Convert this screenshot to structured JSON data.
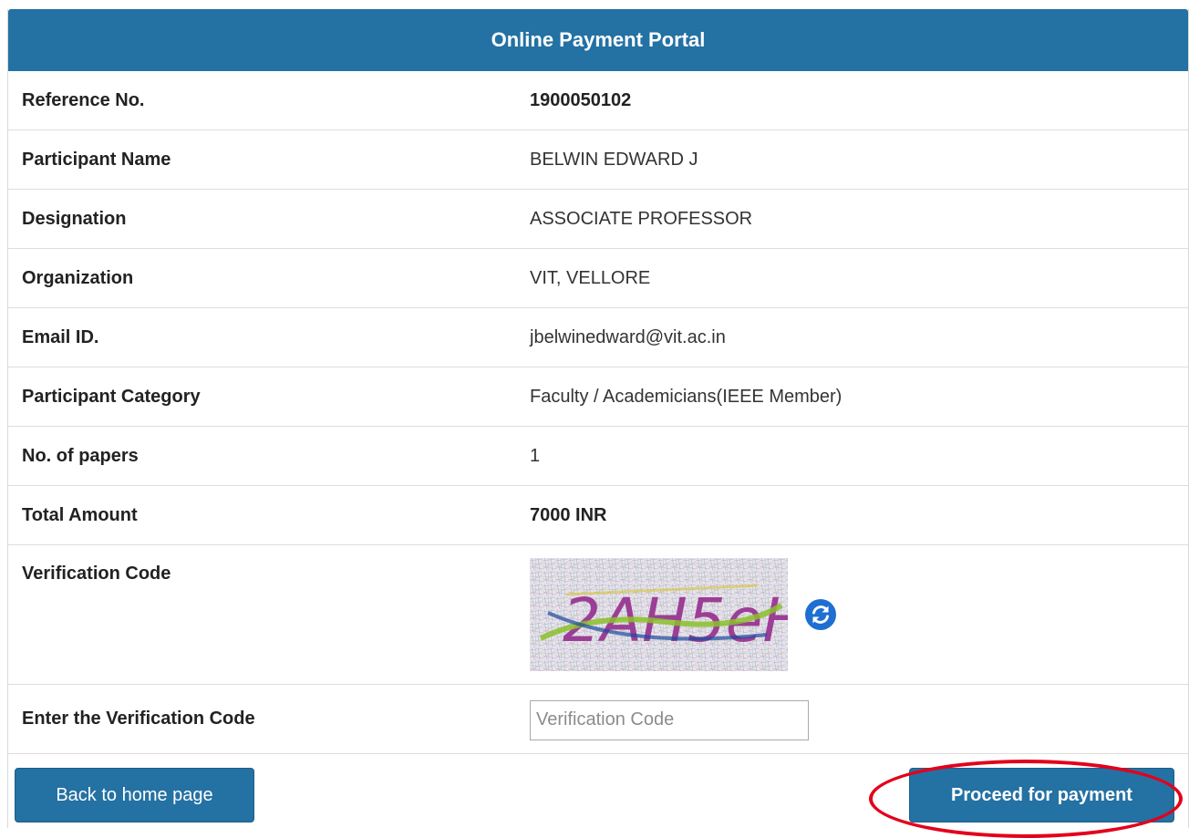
{
  "portal": {
    "title": "Online Payment Portal"
  },
  "fields": {
    "reference": {
      "label": "Reference No.",
      "value": "1900050102"
    },
    "participant_name": {
      "label": "Participant Name",
      "value": "BELWIN EDWARD J"
    },
    "designation": {
      "label": "Designation",
      "value": "ASSOCIATE PROFESSOR"
    },
    "organization": {
      "label": "Organization",
      "value": "VIT, VELLORE"
    },
    "email": {
      "label": "Email ID.",
      "value": "jbelwinedward@vit.ac.in"
    },
    "category": {
      "label": "Participant Category",
      "value": "Faculty / Academicians(IEEE Member)"
    },
    "papers": {
      "label": "No. of papers",
      "value": "1"
    },
    "total": {
      "label": "Total Amount",
      "value": "7000 INR"
    }
  },
  "verification": {
    "label": "Verification Code",
    "captcha_text": "2AH5eH",
    "refresh_icon": "refresh-icon",
    "entry_label": "Enter the Verification Code",
    "input_value": "",
    "input_placeholder": "Verification Code"
  },
  "actions": {
    "back_label": "Back to home page",
    "proceed_label": "Proceed for payment"
  },
  "colors": {
    "header": "#2471a3",
    "button": "#2471a3",
    "highlight_ring": "#e3001b"
  }
}
